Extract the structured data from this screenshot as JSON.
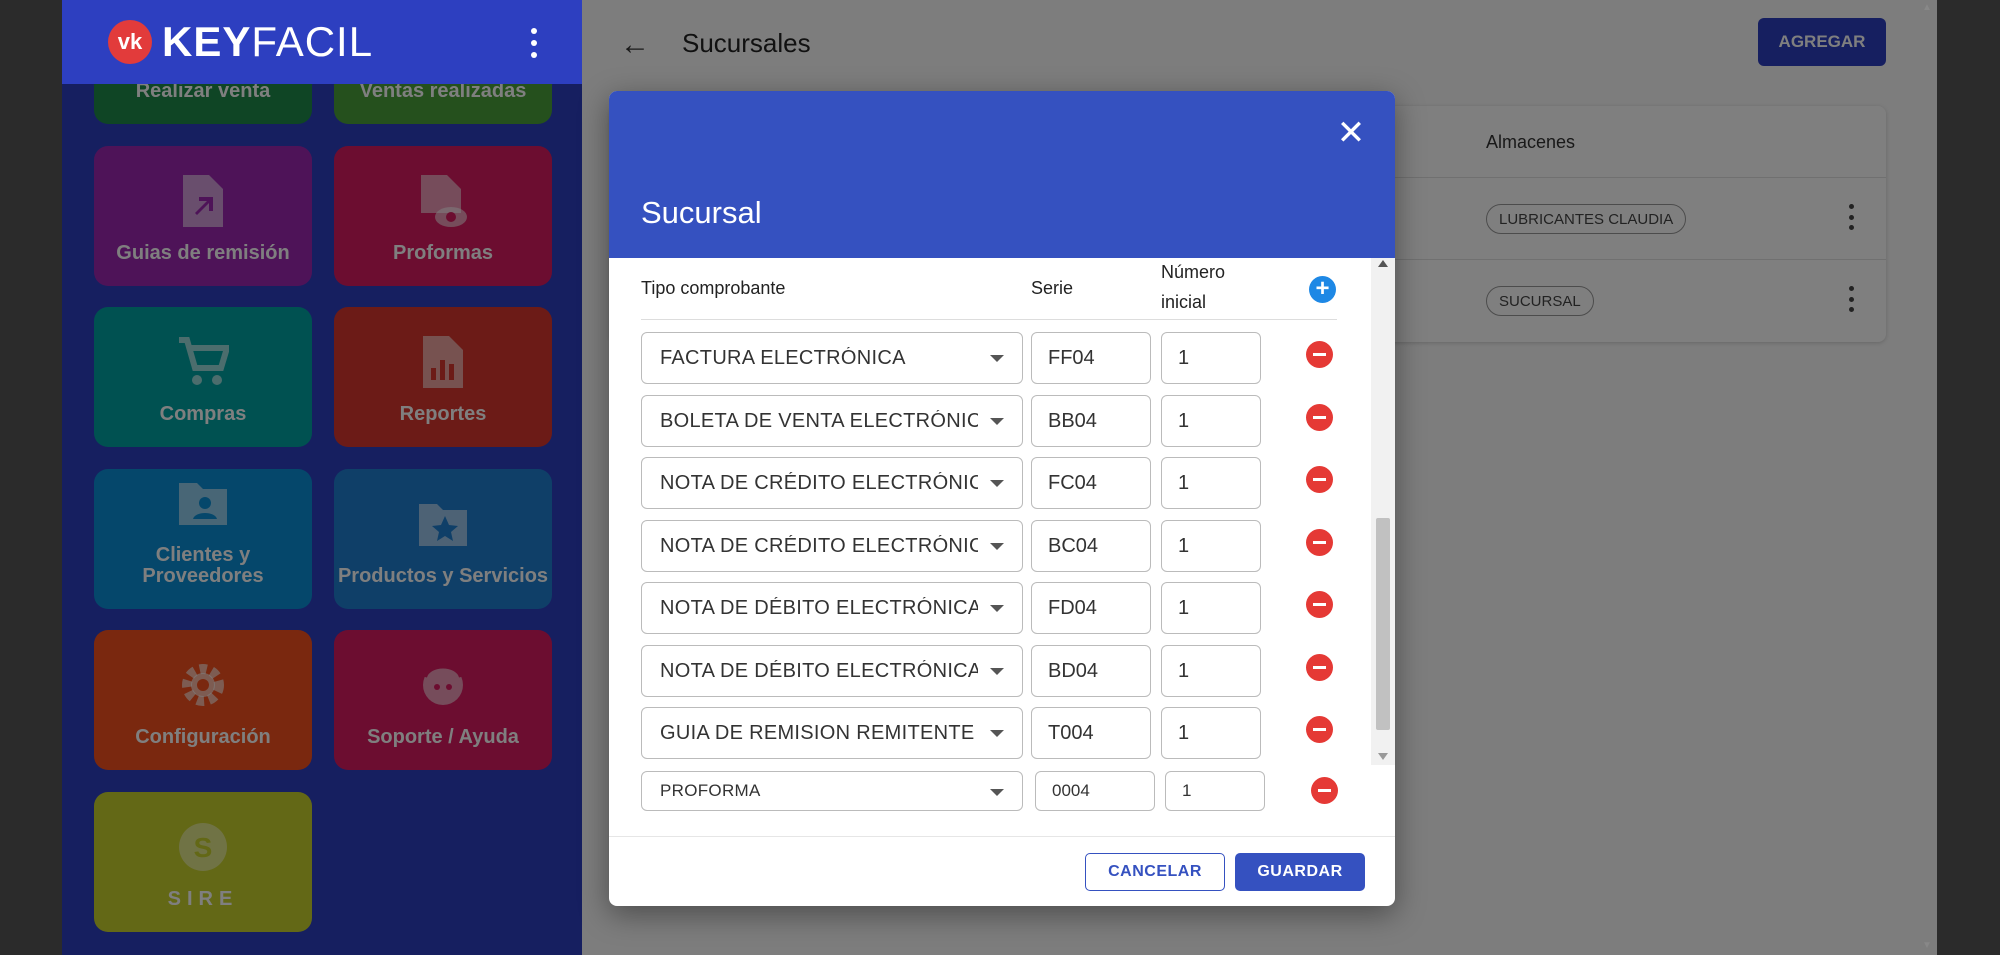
{
  "app": {
    "logo_mark": "vk",
    "logo_bold": "KEY",
    "logo_light": "FACIL"
  },
  "sidebar": {
    "tiles": [
      {
        "label": "Realizar venta",
        "color": "#1f8a4a",
        "icon": "cart-icon"
      },
      {
        "label": "Ventas realizadas",
        "color": "#4aa03a",
        "icon": "list-icon"
      },
      {
        "label": "Guias de remisión",
        "color": "#9c27b0",
        "icon": "file-export-icon"
      },
      {
        "label": "Proformas",
        "color": "#d81b60",
        "icon": "file-eye-icon"
      },
      {
        "label": "Compras",
        "color": "#00a3a3",
        "icon": "cart-icon"
      },
      {
        "label": "Reportes",
        "color": "#d9362e",
        "icon": "file-chart-icon"
      },
      {
        "label": "Clientes y Proveedores",
        "color": "#0a8fd6",
        "icon": "folder-user-icon"
      },
      {
        "label": "Productos y Servicios",
        "color": "#1f7fd1",
        "icon": "folder-star-icon"
      },
      {
        "label": "Configuración",
        "color": "#f4511e",
        "icon": "gear-icon"
      },
      {
        "label": "Soporte / Ayuda",
        "color": "#d81b60",
        "icon": "support-agent-icon"
      },
      {
        "label": "SIRE",
        "color": "#c7d12c",
        "icon": "sire-icon"
      }
    ]
  },
  "header": {
    "title": "Sucursales",
    "add_label": "AGREGAR"
  },
  "table": {
    "column_almacenes": "Almacenes",
    "rows": [
      {
        "almacen": "LUBRICANTES CLAUDIA"
      },
      {
        "almacen": "SUCURSAL"
      }
    ]
  },
  "dialog": {
    "title": "Sucursal",
    "col_tipo": "Tipo comprobante",
    "col_serie": "Serie",
    "col_numero_1": "Número",
    "col_numero_2": "inicial",
    "rows": [
      {
        "tipo": "FACTURA ELECTRÓNICA",
        "serie": "FF04",
        "numero": "1"
      },
      {
        "tipo": "BOLETA DE VENTA ELECTRÓNICA",
        "serie": "BB04",
        "numero": "1"
      },
      {
        "tipo": "NOTA DE CRÉDITO ELECTRÓNICA",
        "serie": "FC04",
        "numero": "1"
      },
      {
        "tipo": "NOTA DE CRÉDITO ELECTRÓNICA",
        "serie": "BC04",
        "numero": "1"
      },
      {
        "tipo": "NOTA DE DÉBITO ELECTRÓNICA",
        "serie": "FD04",
        "numero": "1"
      },
      {
        "tipo": "NOTA DE DÉBITO ELECTRÓNICA",
        "serie": "BD04",
        "numero": "1"
      },
      {
        "tipo": "GUIA DE REMISION REMITENTE EL",
        "serie": "T004",
        "numero": "1"
      },
      {
        "tipo": "PROFORMA",
        "serie": "0004",
        "numero": "1"
      }
    ],
    "cancel_label": "CANCELAR",
    "save_label": "GUARDAR"
  },
  "colors": {
    "primary": "#2d3fc0",
    "dialog_header": "#3551c0",
    "remove": "#e53935",
    "add": "#1e88e5"
  }
}
